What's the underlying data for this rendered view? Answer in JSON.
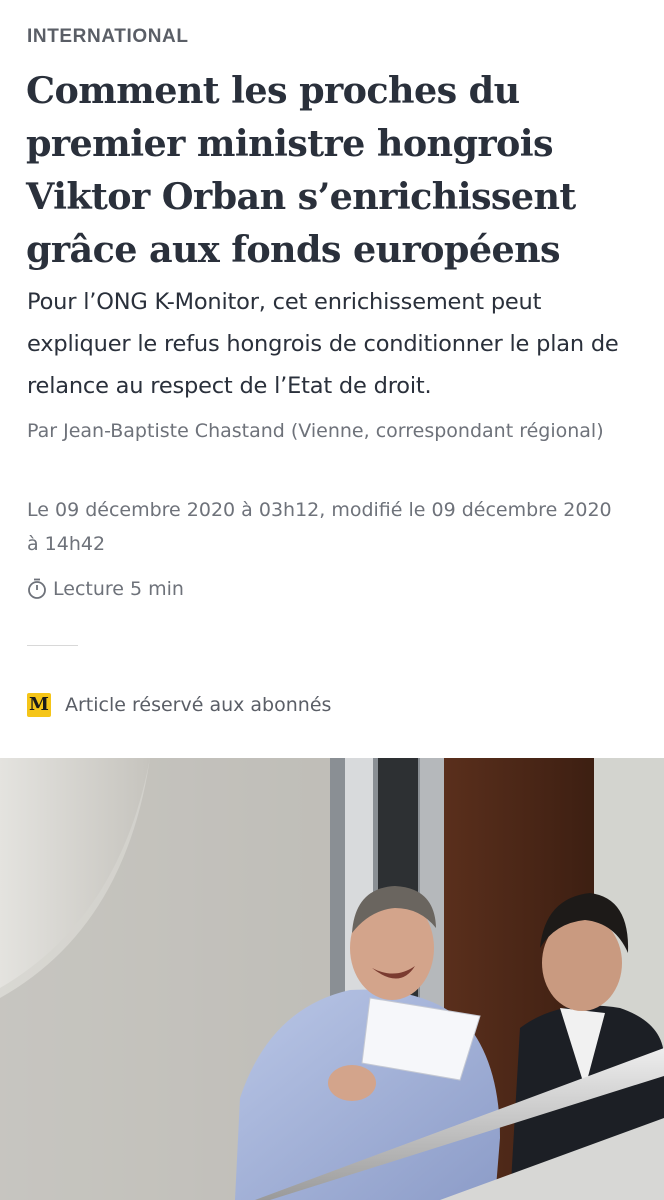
{
  "article": {
    "rubric": "INTERNATIONAL",
    "headline": "Comment les proches du premier ministre hongrois Viktor Orban s’enrichissent grâce aux fonds européens",
    "standfirst": "Pour l’ONG K-Monitor, cet enrichissement peut expliquer le refus hongrois de conditionner le plan de relance au respect de l’Etat de droit.",
    "byline": "Par Jean-Baptiste Chastand (Vienne, correspondant régional)",
    "dates": "Le 09 décembre 2020 à 03h12, modifié le 09 décembre 2020 à 14h42",
    "reading_time": "Lecture 5 min",
    "subscriber_label": "Article réservé aux abonnés",
    "subscriber_badge_glyph": "M"
  },
  "colors": {
    "text": "#2a303b",
    "muted": "#6e727a",
    "badge": "#f5c518"
  },
  "icons": {
    "reading": "stopwatch-icon",
    "subscriber": "le-monde-m-icon"
  }
}
